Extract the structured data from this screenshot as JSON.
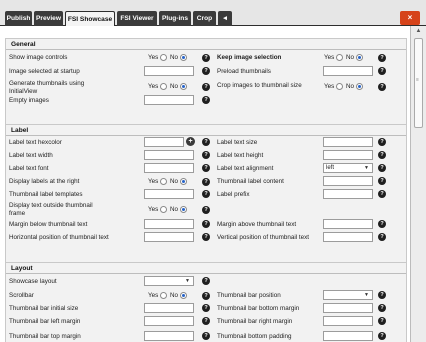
{
  "tabs": [
    "Publish",
    "Preview",
    "FSI Showcase",
    "FSI Viewer",
    "Plug-ins",
    "Crop",
    "◄"
  ],
  "close_label": "×",
  "radio": {
    "yes": "Yes",
    "no": "No"
  },
  "help_glyph": "?",
  "general": {
    "title": "General",
    "show_image_controls": "Show image controls",
    "keep_image_selection": "Keep image selection",
    "image_selected_at_startup": "Image selected at startup",
    "preload_thumbnails": "Preload thumbnails",
    "generate_thumbnails": "Generate thumbnails using InitialView",
    "crop_images": "Crop images to thumbnail size",
    "empty_images": "Empty images"
  },
  "label": {
    "title": "Label",
    "label_text_hexcolor": "Label text hexcolor",
    "label_text_size": "Label text size",
    "label_text_width": "Label text width",
    "label_text_height": "Label text height",
    "label_text_font": "Label text font",
    "label_text_alignment": "Label text alignment",
    "label_text_alignment_value": "left",
    "display_labels_at_right": "Display labels at the right",
    "thumbnail_label_content": "Thumbnail label content",
    "thumbnail_label_templates": "Thumbnail label templates",
    "label_prefix": "Label prefix",
    "display_text_outside_frame": "Display text outside thumbnail frame",
    "margin_below_thumbnail_text": "Margin below thumbnail text",
    "margin_above_thumbnail_text": "Margin above thumbnail text",
    "horizontal_position": "Horizontal position of thumbnail text",
    "vertical_position": "Vertical position of thumbnail text"
  },
  "layout": {
    "title": "Layout",
    "showcase_layout": "Showcase layout",
    "scrollbar": "Scrollbar",
    "thumbnail_bar_position": "Thumbnail bar position",
    "thumbnail_bar_initial_size": "Thumbnail bar initial size",
    "thumbnail_bar_bottom_margin": "Thumbnail bar bottom margin",
    "thumbnail_bar_left_margin": "Thumbnail bar left margin",
    "thumbnail_bar_right_margin": "Thumbnail bar right margin",
    "thumbnail_bar_top_margin": "Thumbnail bar top margin",
    "thumbnail_bottom_padding": "Thumbnail bottom padding"
  },
  "colors": {
    "tab_dark": "#3b3b3b",
    "tab_active": "#f4f4f4",
    "close_button": "#d6431a",
    "radio_selected": "#2763c9",
    "section_bg": "#f2f2f2",
    "help_icon": "#1f1f1f"
  }
}
